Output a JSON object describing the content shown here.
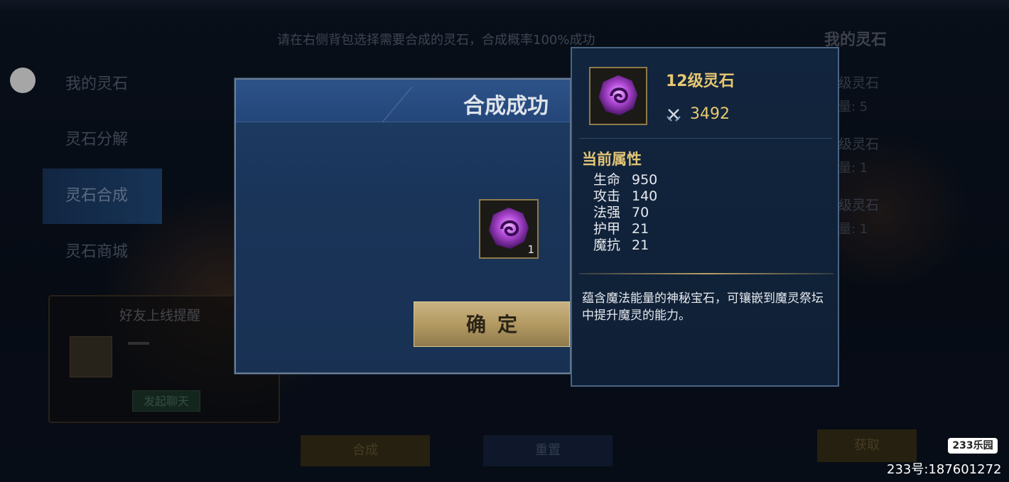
{
  "instruction": "请在右侧背包选择需要合成的灵石，合成概率100%成功",
  "right_panel": {
    "title": "我的灵石",
    "items": [
      {
        "name": "级灵石",
        "count": "量: 5"
      },
      {
        "name": "级灵石",
        "count": "量: 1"
      },
      {
        "name": "级灵石",
        "count": "量: 1"
      }
    ]
  },
  "side_menu": {
    "items": [
      {
        "label": "我的灵石"
      },
      {
        "label": "灵石分解"
      },
      {
        "label": "灵石合成"
      },
      {
        "label": "灵石商城"
      }
    ]
  },
  "friend_card": {
    "title": "好友上线提醒",
    "chat_button": "发起聊天"
  },
  "bottom_buttons": {
    "synth": "合成",
    "reset": "重置",
    "get": "获取"
  },
  "modal": {
    "title": "合成成功",
    "item_count": "1",
    "confirm": "确定"
  },
  "tooltip": {
    "name": "12级灵石",
    "power": "3492",
    "section_title": "当前属性",
    "stats": [
      {
        "label": "生命",
        "value": "950"
      },
      {
        "label": "攻击",
        "value": "140"
      },
      {
        "label": "法强",
        "value": "70"
      },
      {
        "label": "护甲",
        "value": "21"
      },
      {
        "label": "魔抗",
        "value": "21"
      }
    ],
    "description": "蕴含魔法能量的神秘宝石，可镶嵌到魔灵祭坛中提升魔灵的能力。"
  },
  "watermark": {
    "badge": "233乐园",
    "id_text": "233号:187601272"
  },
  "colors": {
    "gold_text": "#e8c870",
    "modal_blue": "#1f3d66",
    "confirm_gold": "#c9b383"
  }
}
